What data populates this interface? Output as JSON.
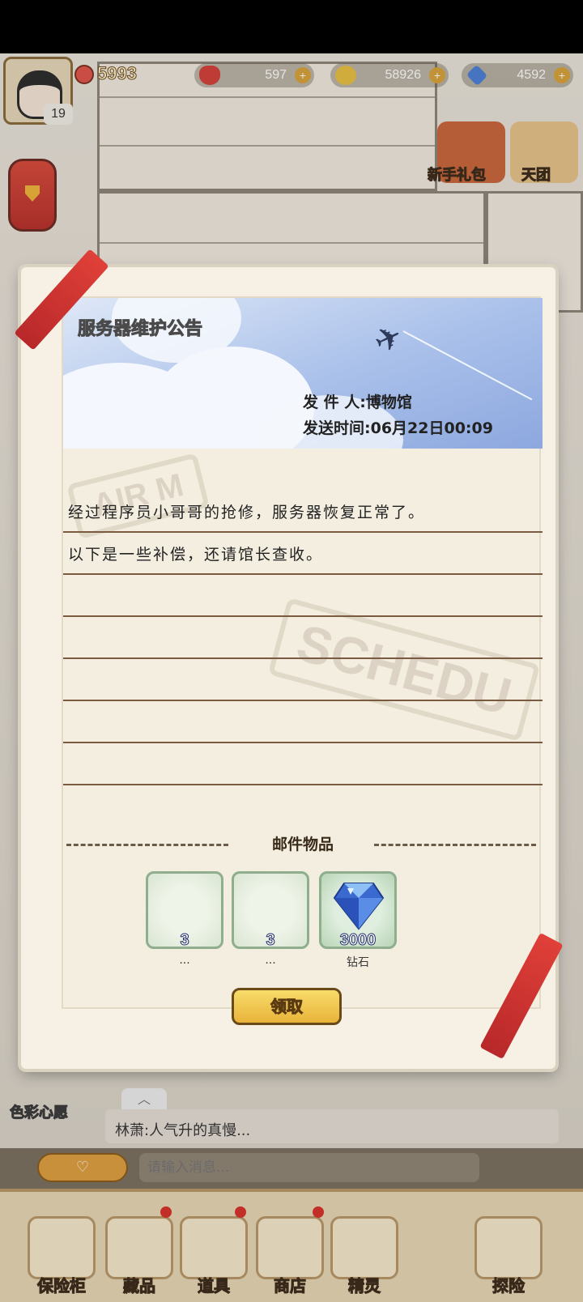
{
  "hud": {
    "level": "19",
    "gold": "5993",
    "hearts": "597",
    "flowers": "58926",
    "gems": "4592",
    "plus_icon": "+",
    "gift_label": "新手礼包",
    "team_label": "天团"
  },
  "mail": {
    "title": "服务器维护公告",
    "sender": "发 件 人:博物馆",
    "send_time": "发送时间:06月22日00:09",
    "lines": [
      "经过程序员小哥哥的抢修，服务器恢复正常了。",
      "以下是一些补偿，还请馆长查收。"
    ],
    "stamp_text_1": "AIR M",
    "stamp_text_2": "SCHEDU",
    "attachments_header": "邮件物品",
    "attachments": [
      {
        "count": "3",
        "name": "..."
      },
      {
        "count": "3",
        "name": "..."
      },
      {
        "count": "3000",
        "name": "钻石"
      }
    ],
    "claim_label": "领取"
  },
  "chat": {
    "color_wish_label": "色彩心愿",
    "last_message": "林萧:人气升的真慢...",
    "input_placeholder": "请输入消息...",
    "up_arrow": "︿"
  },
  "dock": {
    "items": [
      {
        "label": "保险柜"
      },
      {
        "label": "藏品"
      },
      {
        "label": "道具"
      },
      {
        "label": "商店"
      },
      {
        "label": "精灵"
      },
      {
        "label": "探险"
      }
    ]
  },
  "colors": {
    "ribbon": "#d8343a",
    "claim_button": "#f0c850",
    "banner_sky": "#a9c0ea"
  }
}
